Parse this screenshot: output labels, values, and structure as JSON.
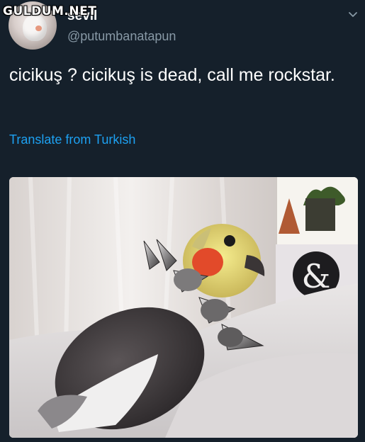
{
  "watermark": "GULDUM.NET",
  "author": {
    "display_name": "sevil",
    "handle": "@putumbanatapun"
  },
  "tweet": {
    "text": "cicikuş ? cicikuş is dead, call me rockstar.",
    "translate_label": "Translate from Turkish"
  },
  "media": {
    "sign_text": "&"
  },
  "icons": {
    "menu": "chevron-down-icon"
  },
  "colors": {
    "background": "#15202b",
    "link": "#1da1f2",
    "secondary_text": "#8899a6"
  }
}
